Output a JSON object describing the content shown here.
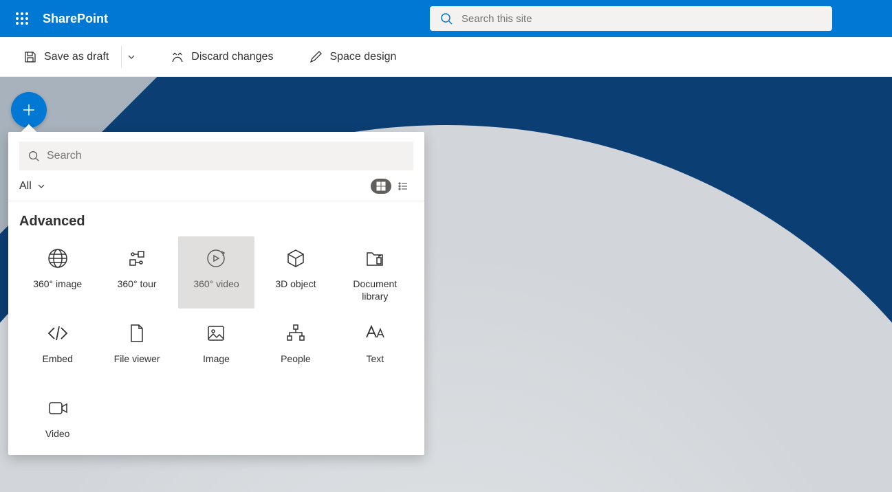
{
  "header": {
    "brand": "SharePoint",
    "search_placeholder": "Search this site"
  },
  "commandbar": {
    "save_label": "Save as draft",
    "discard_label": "Discard changes",
    "design_label": "Space design"
  },
  "flyout": {
    "search_placeholder": "Search",
    "filter_label": "All",
    "section_title": "Advanced",
    "items": [
      {
        "label": "360° image",
        "icon": "globe-icon"
      },
      {
        "label": "360° tour",
        "icon": "tour-icon"
      },
      {
        "label": "360° video",
        "icon": "replay-icon",
        "selected": true
      },
      {
        "label": "3D object",
        "icon": "cube-icon"
      },
      {
        "label": "Document library",
        "icon": "doclib-icon"
      },
      {
        "label": "Embed",
        "icon": "code-icon"
      },
      {
        "label": "File viewer",
        "icon": "file-icon"
      },
      {
        "label": "Image",
        "icon": "image-icon"
      },
      {
        "label": "People",
        "icon": "people-icon"
      },
      {
        "label": "Text",
        "icon": "text-icon"
      },
      {
        "label": "Video",
        "icon": "video-icon"
      }
    ]
  }
}
